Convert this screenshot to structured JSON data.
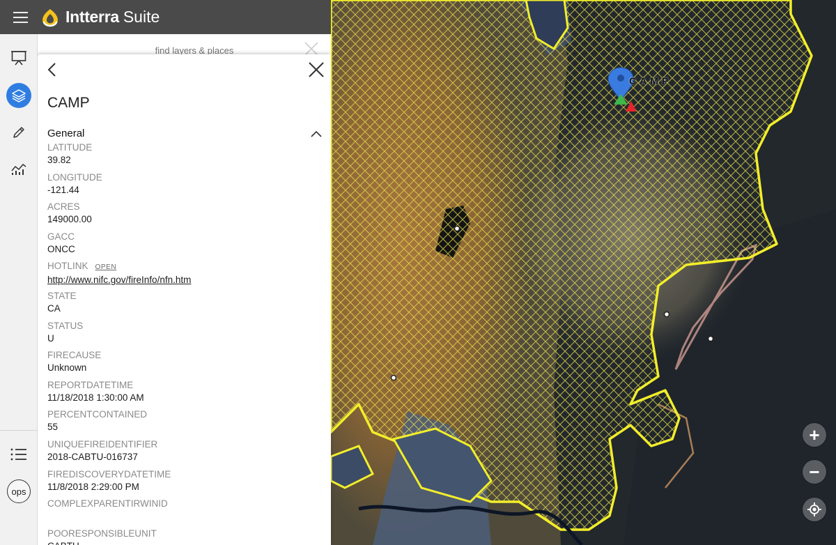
{
  "app": {
    "brand": "Intterra",
    "brand_suffix": "Suite"
  },
  "toolbar": {
    "ops_label": "ops"
  },
  "search": {
    "placeholder": "find layers & places"
  },
  "panel": {
    "title": "CAMP",
    "section_title": "General",
    "hotlink_open_label": "OPEN",
    "fields": [
      {
        "key": "LATITUDE",
        "value": "39.82"
      },
      {
        "key": "LONGITUDE",
        "value": "-121.44"
      },
      {
        "key": "ACRES",
        "value": "149000.00"
      },
      {
        "key": "GACC",
        "value": "ONCC"
      },
      {
        "key": "HOTLINK",
        "value": "http://www.nifc.gov/fireInfo/nfn.htm"
      },
      {
        "key": "STATE",
        "value": "CA"
      },
      {
        "key": "STATUS",
        "value": "U"
      },
      {
        "key": "FIRECAUSE",
        "value": "Unknown"
      },
      {
        "key": "REPORTDATETIME",
        "value": "11/18/2018 1:30:00 AM"
      },
      {
        "key": "PERCENTCONTAINED",
        "value": "55"
      },
      {
        "key": "UNIQUEFIREIDENTIFIER",
        "value": "2018-CABTU-016737"
      },
      {
        "key": "FIREDISCOVERYDATETIME",
        "value": "11/8/2018 2:29:00 PM"
      },
      {
        "key": "COMPLEXPARENTIRWINID",
        "value": ""
      },
      {
        "key": "POORESPONSIBLEUNIT",
        "value": "CABTU"
      }
    ]
  },
  "map": {
    "fire_label": "CAMP",
    "zoom_in": "+",
    "zoom_out": "−",
    "colors": {
      "perimeter": "#f2ee2a",
      "marker": "#3a7be0",
      "active_tool": "#2f7de1"
    }
  }
}
